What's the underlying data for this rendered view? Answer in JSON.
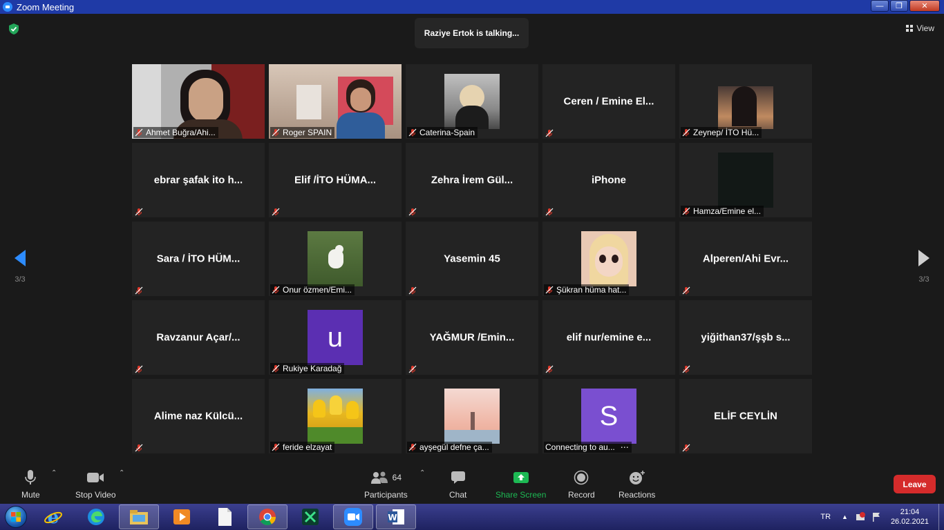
{
  "window": {
    "title": "Zoom Meeting"
  },
  "header": {
    "talking": "Raziye Ertok is talking...",
    "view_label": "View"
  },
  "nav": {
    "left_page": "3/3",
    "right_page": "3/3"
  },
  "participants": [
    {
      "name": "Ahmet Buğra/Ahi...",
      "type": "camera"
    },
    {
      "name": "Roger SPAIN",
      "type": "camera"
    },
    {
      "name": "Caterina-Spain",
      "type": "thumb"
    },
    {
      "name": "Ceren / Emine El...",
      "type": "text"
    },
    {
      "name": "Zeynep/ İTO Hü...",
      "type": "thumb"
    },
    {
      "name": "ebrar şafak ito h...",
      "type": "text"
    },
    {
      "name": "Elif /İTO HÜMA...",
      "type": "text"
    },
    {
      "name": "Zehra İrem Gül...",
      "type": "text"
    },
    {
      "name": "iPhone",
      "type": "text"
    },
    {
      "name": "Hamza/Emine el...",
      "type": "thumb"
    },
    {
      "name": "Sara / İTO HÜM...",
      "type": "text"
    },
    {
      "name": "Onur özmen/Emi...",
      "type": "thumb"
    },
    {
      "name": "Yasemin 45",
      "type": "text"
    },
    {
      "name": "Şükran hüma hat...",
      "type": "thumb"
    },
    {
      "name": "Alperen/Ahi Evr...",
      "type": "text"
    },
    {
      "name": "Ravzanur Açar/...",
      "type": "text"
    },
    {
      "name": "Rukiye Karadağ",
      "type": "avatar",
      "initial": "u",
      "color": "#5b2fb2"
    },
    {
      "name": "YAĞMUR /Emin...",
      "type": "text"
    },
    {
      "name": "elif nur/emine e...",
      "type": "text"
    },
    {
      "name": "yiğithan37/şşb s...",
      "type": "text"
    },
    {
      "name": "Alime naz Külcü...",
      "type": "text"
    },
    {
      "name": "feride elzayat",
      "type": "thumb"
    },
    {
      "name": "ayşegül defne ça...",
      "type": "thumb"
    },
    {
      "name": "Connecting to au...",
      "type": "avatar",
      "initial": "S",
      "color": "#7a4fd0"
    },
    {
      "name": "ELİF CEYLİN",
      "type": "text"
    }
  ],
  "toolbar": {
    "mute": "Mute",
    "stop_video": "Stop Video",
    "participants": "Participants",
    "participant_count": "64",
    "chat": "Chat",
    "share_screen": "Share Screen",
    "record": "Record",
    "reactions": "Reactions",
    "leave": "Leave"
  },
  "taskbar": {
    "language": "TR",
    "time": "21:04",
    "date": "26.02.2021"
  },
  "colors": {
    "accent_blue": "#2d8cff",
    "share_green": "#1db954",
    "leave_red": "#d52b2b",
    "mic_off_red": "#e0392b"
  }
}
